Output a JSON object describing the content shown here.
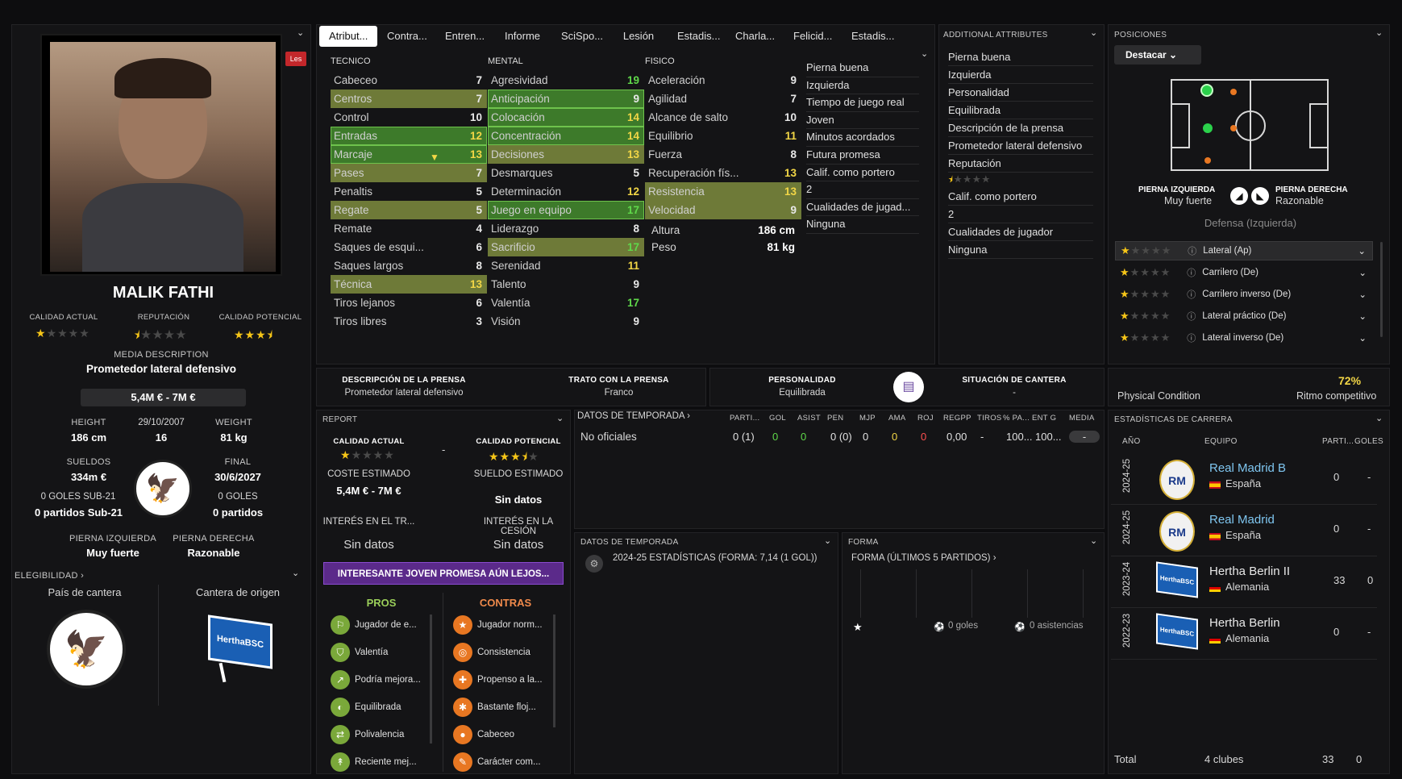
{
  "tabs": [
    "Atribut...",
    "Contra...",
    "Entren...",
    "Informe",
    "SciSpo...",
    "Lesión",
    "Estadis...",
    "Charla...",
    "Felicid...",
    "Estadis..."
  ],
  "profile": {
    "name": "MALIK FATHI",
    "tag": "Les",
    "labels": {
      "ca": "CALIDAD ACTUAL",
      "rep": "REPUTACIÓN",
      "cp": "CALIDAD POTENCIAL"
    },
    "ca_stars": 1,
    "rep_stars": 0.5,
    "cp_stars": 3.5,
    "media_label": "MEDIA DESCRIPTION",
    "media_value": "Prometedor lateral defensivo",
    "value": "5,4M € - 7M €",
    "height_label": "HEIGHT",
    "height": "186 cm",
    "dob": "29/10/2007",
    "age": "16",
    "weight_label": "WEIGHT",
    "weight": "81 kg",
    "wage_label": "SUELDOS",
    "wage": "334m €",
    "end_label": "FINAL",
    "end": "30/6/2027",
    "u21_goals": "0 GOLES SUB-21",
    "u21_apps": "0 partidos Sub-21",
    "goals": "0 GOLES",
    "apps": "0 partidos",
    "left_foot_label": "PIERNA IZQUIERDA",
    "left_foot": "Muy fuerte",
    "right_foot_label": "PIERNA DERECHA",
    "right_foot": "Razonable",
    "elig": "ELEGIBILIDAD ›",
    "youth_nation": "País de cantera",
    "youth_club": "Cantera de origen"
  },
  "technical": {
    "head": "TECNICO",
    "rows": [
      {
        "n": "Cabeceo",
        "v": "7",
        "h": "",
        "c": "vw"
      },
      {
        "n": "Centros",
        "v": "7",
        "h": "olive",
        "c": "vw"
      },
      {
        "n": "Control",
        "v": "10",
        "h": "",
        "c": "vw"
      },
      {
        "n": "Entradas",
        "v": "12",
        "h": "green",
        "c": "vy"
      },
      {
        "n": "Marcaje",
        "v": "13",
        "h": "green",
        "c": "vy"
      },
      {
        "n": "Pases",
        "v": "7",
        "h": "olive",
        "c": "vw"
      },
      {
        "n": "Penaltis",
        "v": "5",
        "h": "",
        "c": "vw"
      },
      {
        "n": "Regate",
        "v": "5",
        "h": "olive",
        "c": "vw"
      },
      {
        "n": "Remate",
        "v": "4",
        "h": "",
        "c": "vw"
      },
      {
        "n": "Saques de esqui...",
        "v": "6",
        "h": "",
        "c": "vw"
      },
      {
        "n": "Saques largos",
        "v": "8",
        "h": "",
        "c": "vw"
      },
      {
        "n": "Técnica",
        "v": "13",
        "h": "olive",
        "c": "vy"
      },
      {
        "n": "Tiros lejanos",
        "v": "6",
        "h": "",
        "c": "vw"
      },
      {
        "n": "Tiros libres",
        "v": "3",
        "h": "",
        "c": "vw"
      }
    ]
  },
  "mental": {
    "head": "MENTAL",
    "rows": [
      {
        "n": "Agresividad",
        "v": "19",
        "h": "",
        "c": "vg"
      },
      {
        "n": "Anticipación",
        "v": "9",
        "h": "green",
        "c": "vw"
      },
      {
        "n": "Colocación",
        "v": "14",
        "h": "green",
        "c": "vy"
      },
      {
        "n": "Concentración",
        "v": "14",
        "h": "green",
        "c": "vy"
      },
      {
        "n": "Decisiones",
        "v": "13",
        "h": "olive",
        "c": "vy"
      },
      {
        "n": "Desmarques",
        "v": "5",
        "h": "",
        "c": "vw"
      },
      {
        "n": "Determinación",
        "v": "12",
        "h": "",
        "c": "vy"
      },
      {
        "n": "Juego en equipo",
        "v": "17",
        "h": "green",
        "c": "vg"
      },
      {
        "n": "Liderazgo",
        "v": "8",
        "h": "",
        "c": "vw"
      },
      {
        "n": "Sacrificio",
        "v": "17",
        "h": "olive",
        "c": "vg"
      },
      {
        "n": "Serenidad",
        "v": "11",
        "h": "",
        "c": "vy"
      },
      {
        "n": "Talento",
        "v": "9",
        "h": "",
        "c": "vw"
      },
      {
        "n": "Valentía",
        "v": "17",
        "h": "",
        "c": "vg"
      },
      {
        "n": "Visión",
        "v": "9",
        "h": "",
        "c": "vw"
      }
    ]
  },
  "physical": {
    "head": "FISICO",
    "rows": [
      {
        "n": "Aceleración",
        "v": "9",
        "h": "",
        "c": "vw"
      },
      {
        "n": "Agilidad",
        "v": "7",
        "h": "",
        "c": "vw"
      },
      {
        "n": "Alcance de salto",
        "v": "10",
        "h": "",
        "c": "vw"
      },
      {
        "n": "Equilibrio",
        "v": "11",
        "h": "",
        "c": "vy"
      },
      {
        "n": "Fuerza",
        "v": "8",
        "h": "",
        "c": "vw"
      },
      {
        "n": "Recuperación fís...",
        "v": "13",
        "h": "",
        "c": "vy"
      },
      {
        "n": "Resistencia",
        "v": "13",
        "h": "olive",
        "c": "vy"
      },
      {
        "n": "Velocidad",
        "v": "9",
        "h": "olive",
        "c": "vw"
      }
    ],
    "altura_label": "Altura",
    "altura": "186 cm",
    "peso_label": "Peso",
    "peso": "81 kg"
  },
  "side_info": [
    "Pierna buena",
    "Izquierda",
    "Tiempo de juego real",
    "Joven",
    "Minutos acordados",
    "Futura promesa",
    "Calif. como portero",
    "2",
    "Cualidades de jugad...",
    "Ninguna"
  ],
  "additional": {
    "title": "ADDITIONAL ATTRIBUTES",
    "items": [
      "Pierna buena",
      "Izquierda",
      "Personalidad",
      "Equilibrada",
      "Descripción de la prensa",
      "Prometedor lateral defensivo",
      "Reputación",
      "Calif. como portero",
      "2",
      "Cualidades de jugador",
      "Ninguna"
    ]
  },
  "positions": {
    "title": "POSICIONES",
    "filter": "Destacar",
    "left_label": "PIERNA IZQUIERDA",
    "left_val": "Muy fuerte",
    "right_label": "PIERNA DERECHA",
    "right_val": "Razonable",
    "main": "Defensa (Izquierda)",
    "roles": [
      "Lateral (Ap)",
      "Carrilero (De)",
      "Carrilero inverso (De)",
      "Lateral práctico (De)",
      "Lateral inverso (De)"
    ]
  },
  "press": {
    "desc_label": "DESCRIPCIÓN DE LA PRENSA",
    "desc": "Prometedor lateral defensivo",
    "trato_label": "TRATO CON LA PRENSA",
    "trato": "Franco",
    "pers_label": "PERSONALIDAD",
    "pers": "Equilibrada",
    "cantera_label": "SITUACIÓN DE CANTERA",
    "cantera": "-"
  },
  "condition": {
    "label": "Physical Condition",
    "pct": "72%",
    "ritmo": "Ritmo competitivo"
  },
  "report": {
    "title": "REPORT",
    "ca": "CALIDAD ACTUAL",
    "cp": "CALIDAD POTENCIAL",
    "dash": "-",
    "coste_label": "COSTE ESTIMADO",
    "coste": "5,4M € - 7M €",
    "sueldo_label": "SUELDO ESTIMADO",
    "sueldo": "Sin datos",
    "int_tr_label": "INTERÉS EN EL TR...",
    "int_tr": "Sin datos",
    "int_ces_label": "INTERÉS EN LA CESIÓN",
    "int_ces": "Sin datos",
    "banner": "INTERESANTE JOVEN PROMESA AÚN LEJOS...",
    "pros_label": "PROS",
    "cons_label": "CONTRAS",
    "pros": [
      "Jugador de e...",
      "Valentía",
      "Podría mejora...",
      "Equilibrada",
      "Polivalencia",
      "Reciente mej..."
    ],
    "cons": [
      "Jugador norm...",
      "Consistencia",
      "Propenso a la...",
      "Bastante floj...",
      "Cabeceo",
      "Carácter com..."
    ]
  },
  "season": {
    "title": "DATOS DE TEMPORADA ›",
    "cols": [
      "PARTI...",
      "GOL",
      "ASIST",
      "PEN",
      "MJP",
      "AMA",
      "ROJ",
      "REGPP",
      "TIROS",
      "% PA...",
      "ENT G",
      "MEDIA"
    ],
    "row_label": "No oficiales",
    "vals": [
      "0 (1)",
      "0",
      "0",
      "0 (0)",
      "0",
      "0",
      "0",
      "0,00",
      "-",
      "100...",
      "100...",
      "-"
    ]
  },
  "season2": {
    "title": "DATOS DE TEMPORADA",
    "line": "2024-25 ESTADÍSTICAS (FORMA: 7,14 (1 GOL))"
  },
  "form": {
    "title": "FORMA",
    "sub": "FORMA (ÚLTIMOS 5 PARTIDOS) ›",
    "goals": "0 goles",
    "assists": "0 asistencias"
  },
  "career": {
    "title": "ESTADÍSTICAS DE CARRERA",
    "h_year": "AÑO",
    "h_team": "EQUIPO",
    "h_apps": "PARTI...",
    "h_goals": "GOLES",
    "rows": [
      {
        "year": "2024-25",
        "team": "Real Madrid B",
        "country": "España",
        "apps": "0",
        "goals": "-",
        "link": true
      },
      {
        "year": "2024-25",
        "team": "Real Madrid",
        "country": "España",
        "apps": "0",
        "goals": "-",
        "link": true
      },
      {
        "year": "2023-24",
        "team": "Hertha Berlin II",
        "country": "Alemania",
        "apps": "33",
        "goals": "0",
        "link": false
      },
      {
        "year": "2022-23",
        "team": "Hertha Berlin",
        "country": "Alemania",
        "apps": "0",
        "goals": "-",
        "link": false
      }
    ],
    "total_label": "Total",
    "total_clubs": "4 clubes",
    "total_apps": "33",
    "total_goals": "0"
  },
  "colors": {
    "olive": "#6e7a38",
    "green": "#3d7a2a",
    "yellow": "#f2d646",
    "lime": "#5fd84a",
    "link": "#7fc6f0",
    "purple": "#5b2a8a"
  }
}
